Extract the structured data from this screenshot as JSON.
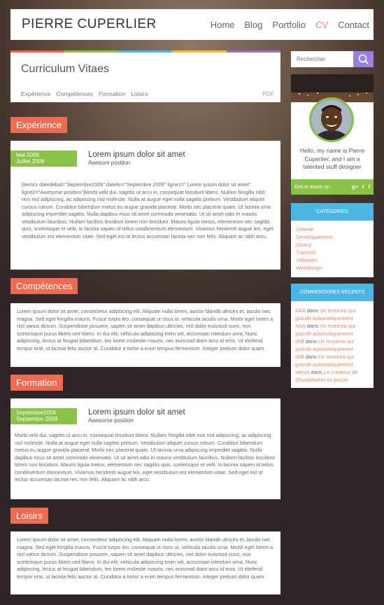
{
  "header": {
    "brand": "PIERRE CUPERLIER",
    "nav": [
      {
        "label": "Home",
        "active": false
      },
      {
        "label": "Blog",
        "active": false
      },
      {
        "label": "Portfolio",
        "active": false
      },
      {
        "label": "CV",
        "active": true
      },
      {
        "label": "Contact",
        "active": false
      }
    ]
  },
  "cv": {
    "title": "Curriculum Vitaes",
    "tabs": [
      "Expérience",
      "Compétences",
      "Formation",
      "Loisirs"
    ],
    "pdf": "PDF"
  },
  "sections": {
    "experience": {
      "label": "Expérience",
      "date_start": "Mai 2006",
      "date_end": "Juillet 2006",
      "title": "Lorem ipsum dolor sit amet",
      "subtitle": "Awesom position",
      "text": "[itemcv datedebut=\"Septembre2006\" datefin=\"Septembre 2009\" ligne1=\" Lorem ipsum dolor sit amet\" ligne2=\"Awesome position\"]Morbi velit dui, sagittis ut arcu in, consequat tincidunt libero. Nullam fringilla nibh non nisl adipiscing, ac adipiscing nisl molestie. Nulla at augue eget nulla sagittis pretium. Vestibulum aliquet cursus rutrum. Curabitur bibendum metus eu augue gravida placerat. Morbi nec placerat quam. Ut lacinia urna adipiscing imperdiet sagittis. Nulla dapibus risus sit amet commodo venenatis. Ut sit amet odio in mauris vestibulum faucibus. Nullam facilisis tincidunt lorem non tincidunt. Mauris ligula metus, elementum nec sagittis quis, scelerisque et velit. In lacinia sapien id tellus condimentum elementum. Vivamus hendrerit augue leo, eget vestibulum est elementum vitae. Sed eget est at lectus accumsan lacinia nec non felis. Aliquam ac nibh arcu."
    },
    "competences": {
      "label": "Compétences",
      "text": " Lorem ipsum dolor sit amet, consectetur adipiscing elit. Aliquam nulla lorem, auctor blandit ultrices et, iaculis nec magna. Sed eget fringilla mauris. Fusce turpis leo, consequat ut risus ut, vehicula iaculis urna. Morbi eget lorem a nisl varius dictum. Suspendisse posuere, sapien sit amet dapibus ultricies, nisl dolor euismod nunc, non scelerisque purus libero sed libero. In dui elit, vehicula adipiscing enim vel, accumsan interdum urna. Nunc adipiscing, lectus at feugiat bibendum, leo lorem molestie mauris, nec euismod diam arcu id eros. Ut eleifend tempor erat, ut lacinia felis auctor at. Curabitur a tortor a enim tempus fermentum. Integer pretium dolor quam."
    },
    "formation": {
      "label": "Formation",
      "date_start": "Septembre2006",
      "date_end": "Septembre 2009",
      "title": "Lorem ipsum dolor sit amet",
      "subtitle": "Awesome position",
      "text": "Morbi velit dui, sagittis ut arcu in, consequat tincidunt libero. Nullam fringilla nibh non nisl adipiscing, ac adipiscing nisl molestie. Nulla at augue eget nulla sagittis pretium. Vestibulum aliquet cursus rutrum. Curabitur bibendum metus eu augue gravida placerat. Morbi nec placerat quam. Ut lacinia urna adipiscing imperdiet sagittis. Nulla dapibus risus sit amet commodo venenatis. Ut sit amet odio in mauris vestibulum faucibus. Nullam facilisis tincidunt lorem non tincidunt. Mauris ligula metus, elementum nec sagittis quis, scelerisque et velit. In lacinia sapien id tellus condimentum elementum. Vivamus hendrerit augue leo, eget vestibulum est elementum vitae. Sed eget est at lectus accumsan lacinia nec non felis. Aliquam ac nibh arcu."
    },
    "loisirs": {
      "label": "Loisirs",
      "text": " Lorem ipsum dolor sit amet, consectetur adipiscing elit. Aliquam nulla lorem, auctor blandit ultrices et, iaculis nec magna. Sed eget fringilla mauris. Fusce turpis leo, consequat ut risus ut, vehicula iaculis urna. Morbi eget lorem a nisl varius dictum. Suspendisse posuere, sapien sit amet dapibus ultricies, nisl dolor euismod nunc, non scelerisque purus libero sed libero. In dui elit, vehicula adipiscing enim vel, accumsan interdum urna. Nunc adipiscing, lectus at feugiat bibendum, leo lorem molestie mauris, nec euismod diam arcu id eros. Ut eleifend tempor erat, ut lacinia felis auctor at. Curabitur a tortor a enim tempus fermentum. Integer pretium dolor quam."
    }
  },
  "sidebar": {
    "search": {
      "placeholder": "Rechercher",
      "icon": "search-icon"
    },
    "profile": {
      "text": "Hello, my name is Pierre Cuperlier, and I am a talented stuff designer",
      "touch": "Get in touch on",
      "social": [
        "g+",
        "t",
        "f"
      ]
    },
    "categories": {
      "title": "CATÉGORIES",
      "items": [
        "Délente",
        "Développement",
        "jQuery",
        "Tutoriels",
        "Utilitaires",
        "Webdesign"
      ]
    },
    "comments": {
      "title": "COMMENTAIRES RÉCENTS",
      "items": [
        {
          "author": "AAA",
          "sep": "dans",
          "post": "Un textarea qui grandit automatiquement"
        },
        {
          "author": "AAA",
          "sep": "dans",
          "post": "Un textarea qui grandit automatiquement"
        },
        {
          "author": "dfdf",
          "sep": "dans",
          "post": "Un textarea qui grandit automatiquement"
        },
        {
          "author": "dfdf",
          "sep": "dans",
          "post": "Un textarea qui grandit automatiquement"
        },
        {
          "author": "admin",
          "sep": "dans",
          "post": "Le créateur de GhostMarket en prison"
        }
      ]
    }
  },
  "colors": {
    "accent_orange": "#ee6a50",
    "accent_green": "#8bc34a",
    "accent_blue": "#4db6e4",
    "accent_purple": "#9b7fe0"
  }
}
